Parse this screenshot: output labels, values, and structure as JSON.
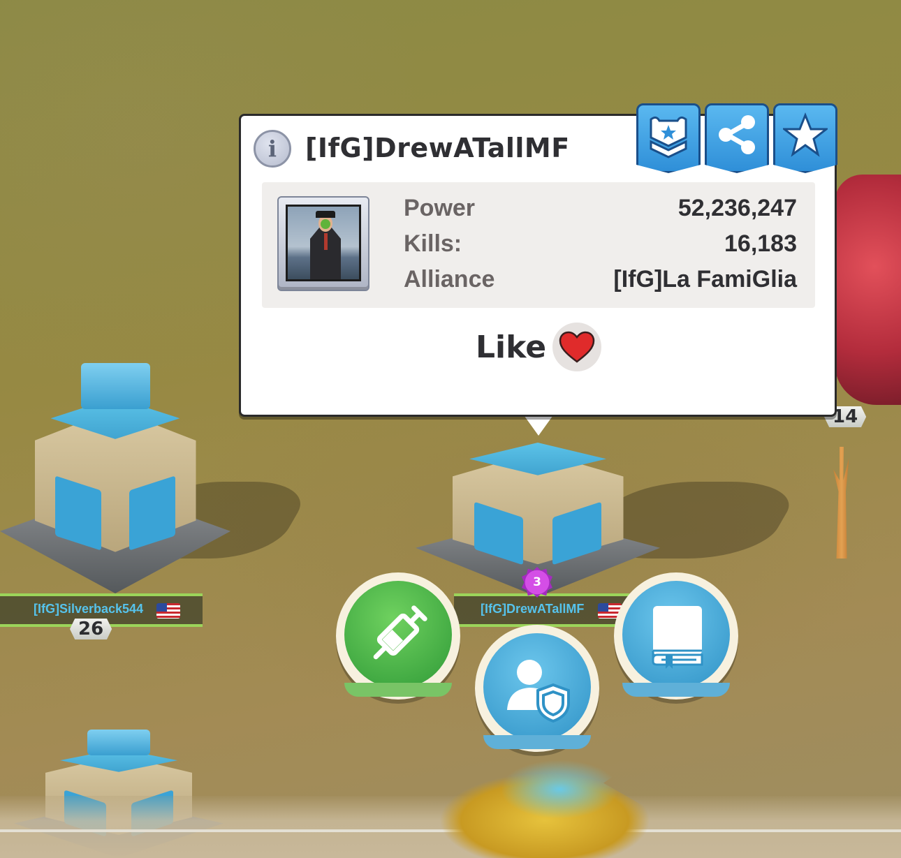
{
  "popup": {
    "player_name": "[IfG]DrewATallMF",
    "stats": [
      {
        "label": "Power",
        "value": "52,236,247"
      },
      {
        "label": "Kills:",
        "value": "16,183"
      },
      {
        "label": "Alliance",
        "value": "[IfG]La FamiGlia"
      }
    ],
    "like_label": "Like",
    "header_buttons": [
      "rank-insignia-icon",
      "share-icon",
      "star-icon"
    ],
    "info_glyph": "i"
  },
  "world": {
    "players": [
      {
        "name": "[IfG]Silverback544",
        "level": "26",
        "flag": "US"
      },
      {
        "name": "[IfG]DrewATallMF",
        "level": "",
        "flag": "US",
        "badge": "3"
      }
    ],
    "other_level": "14"
  },
  "action_buttons": [
    "syringe-icon",
    "player-shield-icon",
    "book-icon"
  ],
  "colors": {
    "accent_blue": "#3fa4e2",
    "green": "#3fae44",
    "name_blue": "#56c3ec",
    "heart_red": "#e02b2b"
  }
}
